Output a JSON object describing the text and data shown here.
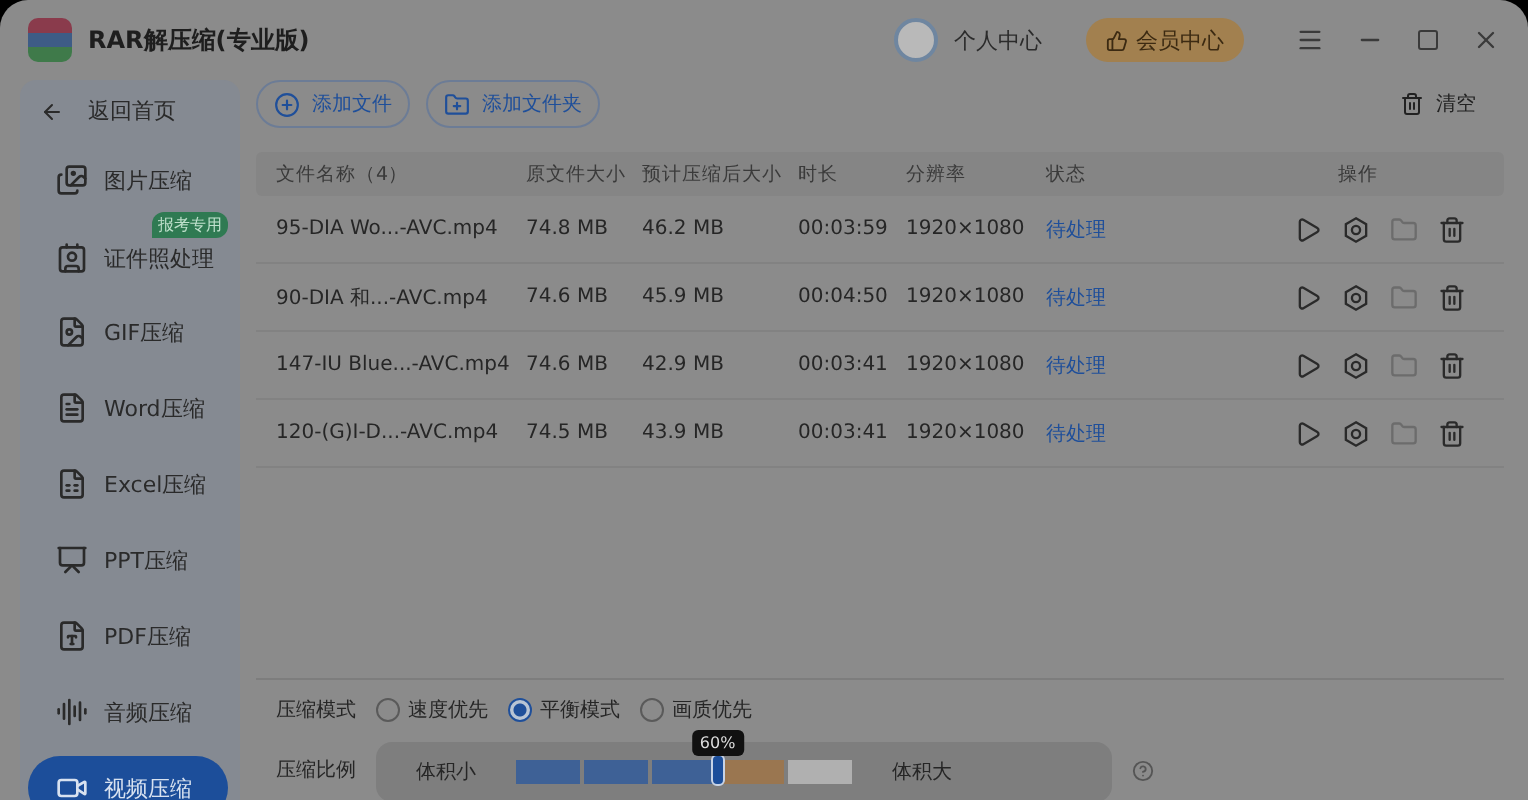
{
  "window": {
    "title": "RAR解压缩(专业版)",
    "user_label": "个人中心",
    "vip_button": "会员中心"
  },
  "sidebar": {
    "back": "返回首页",
    "items": [
      {
        "kind": "image",
        "label": "图片压缩",
        "selected": false
      },
      {
        "kind": "id-photo",
        "label": "证件照处理",
        "selected": false,
        "badge": "报考专用"
      },
      {
        "kind": "gif",
        "label": "GIF压缩",
        "selected": false
      },
      {
        "kind": "word",
        "label": "Word压缩",
        "selected": false
      },
      {
        "kind": "excel",
        "label": "Excel压缩",
        "selected": false
      },
      {
        "kind": "ppt",
        "label": "PPT压缩",
        "selected": false
      },
      {
        "kind": "pdf",
        "label": "PDF压缩",
        "selected": false
      },
      {
        "kind": "audio",
        "label": "音频压缩",
        "selected": false
      },
      {
        "kind": "video",
        "label": "视频压缩",
        "selected": true
      }
    ]
  },
  "toolbar": {
    "add_file": "添加文件",
    "add_folder": "添加文件夹",
    "clear": "清空"
  },
  "table": {
    "columns": [
      "文件名称（4）",
      "原文件大小",
      "预计压缩后大小",
      "时长",
      "分辨率",
      "状态",
      "操作"
    ],
    "rows": [
      {
        "name": "95-DIA Wo...-AVC.mp4",
        "size": "74.8 MB",
        "estimated": "46.2 MB",
        "duration": "00:03:59",
        "resolution": "1920×1080",
        "status": "待处理"
      },
      {
        "name": "90-DIA 和...-AVC.mp4",
        "size": "74.6 MB",
        "estimated": "45.9 MB",
        "duration": "00:04:50",
        "resolution": "1920×1080",
        "status": "待处理"
      },
      {
        "name": "147-IU Blue...-AVC.mp4",
        "size": "74.6 MB",
        "estimated": "42.9 MB",
        "duration": "00:03:41",
        "resolution": "1920×1080",
        "status": "待处理"
      },
      {
        "name": "120-(G)I-D...-AVC.mp4",
        "size": "74.5 MB",
        "estimated": "43.9 MB",
        "duration": "00:03:41",
        "resolution": "1920×1080",
        "status": "待处理"
      }
    ]
  },
  "settings": {
    "mode_label": "压缩模式",
    "modes": [
      {
        "label": "速度优先",
        "selected": false
      },
      {
        "label": "平衡模式",
        "selected": true
      },
      {
        "label": "画质优先",
        "selected": false
      }
    ],
    "ratio_label": "压缩比例",
    "small_label": "体积小",
    "large_label": "体积大",
    "level": 0.6,
    "tooltip": "60%"
  }
}
